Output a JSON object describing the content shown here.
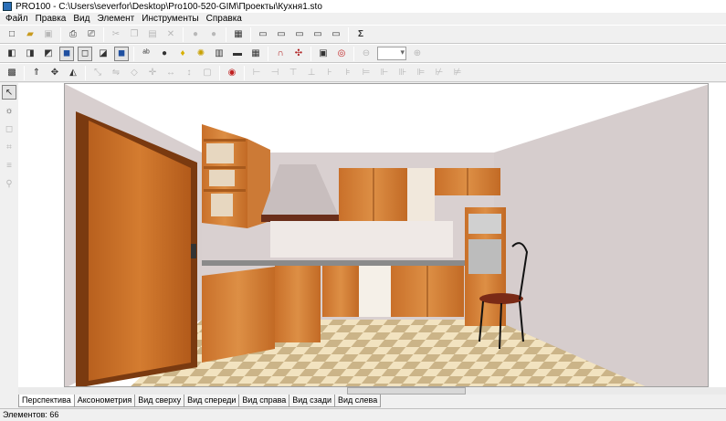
{
  "window": {
    "title": "PRO100 - C:\\Users\\severfor\\Desktop\\Pro100-520-GIM\\Проекты\\Кухня1.sto"
  },
  "menu": [
    "Файл",
    "Правка",
    "Вид",
    "Элемент",
    "Инструменты",
    "Справка"
  ],
  "toolbar1": [
    "new-icon",
    "open-icon",
    "save-icon",
    "print-preview-icon",
    "print-icon",
    "cut-icon",
    "copy-icon",
    "paste-icon",
    "delete-icon",
    "undo-icon",
    "redo-icon",
    "properties-icon",
    "render-icon",
    "screenshot-icon",
    "camera-icon",
    "printer-icon",
    "zoom-icon",
    "sum-icon"
  ],
  "toolbar2_zoom_value": "",
  "tabs": [
    "Перспектива",
    "Аксонометрия",
    "Вид сверху",
    "Вид спереди",
    "Вид справа",
    "Вид сзади",
    "Вид слева"
  ],
  "active_tab": 0,
  "status": {
    "elements": "Элементов: 66"
  },
  "colors": {
    "wood": "#d98b3a",
    "wood_dark": "#b0641f",
    "wall": "#d8cfcf",
    "floor_light": "#f5e6c2",
    "floor_dark": "#cbb488"
  }
}
